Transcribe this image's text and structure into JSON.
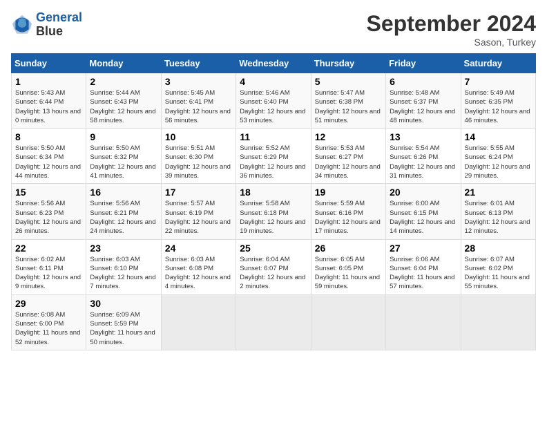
{
  "header": {
    "logo_line1": "General",
    "logo_line2": "Blue",
    "month": "September 2024",
    "location": "Sason, Turkey"
  },
  "weekdays": [
    "Sunday",
    "Monday",
    "Tuesday",
    "Wednesday",
    "Thursday",
    "Friday",
    "Saturday"
  ],
  "weeks": [
    [
      {
        "day": "1",
        "sunrise": "5:43 AM",
        "sunset": "6:44 PM",
        "daylight": "13 hours and 0 minutes."
      },
      {
        "day": "2",
        "sunrise": "5:44 AM",
        "sunset": "6:43 PM",
        "daylight": "12 hours and 58 minutes."
      },
      {
        "day": "3",
        "sunrise": "5:45 AM",
        "sunset": "6:41 PM",
        "daylight": "12 hours and 56 minutes."
      },
      {
        "day": "4",
        "sunrise": "5:46 AM",
        "sunset": "6:40 PM",
        "daylight": "12 hours and 53 minutes."
      },
      {
        "day": "5",
        "sunrise": "5:47 AM",
        "sunset": "6:38 PM",
        "daylight": "12 hours and 51 minutes."
      },
      {
        "day": "6",
        "sunrise": "5:48 AM",
        "sunset": "6:37 PM",
        "daylight": "12 hours and 48 minutes."
      },
      {
        "day": "7",
        "sunrise": "5:49 AM",
        "sunset": "6:35 PM",
        "daylight": "12 hours and 46 minutes."
      }
    ],
    [
      {
        "day": "8",
        "sunrise": "5:50 AM",
        "sunset": "6:34 PM",
        "daylight": "12 hours and 44 minutes."
      },
      {
        "day": "9",
        "sunrise": "5:50 AM",
        "sunset": "6:32 PM",
        "daylight": "12 hours and 41 minutes."
      },
      {
        "day": "10",
        "sunrise": "5:51 AM",
        "sunset": "6:30 PM",
        "daylight": "12 hours and 39 minutes."
      },
      {
        "day": "11",
        "sunrise": "5:52 AM",
        "sunset": "6:29 PM",
        "daylight": "12 hours and 36 minutes."
      },
      {
        "day": "12",
        "sunrise": "5:53 AM",
        "sunset": "6:27 PM",
        "daylight": "12 hours and 34 minutes."
      },
      {
        "day": "13",
        "sunrise": "5:54 AM",
        "sunset": "6:26 PM",
        "daylight": "12 hours and 31 minutes."
      },
      {
        "day": "14",
        "sunrise": "5:55 AM",
        "sunset": "6:24 PM",
        "daylight": "12 hours and 29 minutes."
      }
    ],
    [
      {
        "day": "15",
        "sunrise": "5:56 AM",
        "sunset": "6:23 PM",
        "daylight": "12 hours and 26 minutes."
      },
      {
        "day": "16",
        "sunrise": "5:56 AM",
        "sunset": "6:21 PM",
        "daylight": "12 hours and 24 minutes."
      },
      {
        "day": "17",
        "sunrise": "5:57 AM",
        "sunset": "6:19 PM",
        "daylight": "12 hours and 22 minutes."
      },
      {
        "day": "18",
        "sunrise": "5:58 AM",
        "sunset": "6:18 PM",
        "daylight": "12 hours and 19 minutes."
      },
      {
        "day": "19",
        "sunrise": "5:59 AM",
        "sunset": "6:16 PM",
        "daylight": "12 hours and 17 minutes."
      },
      {
        "day": "20",
        "sunrise": "6:00 AM",
        "sunset": "6:15 PM",
        "daylight": "12 hours and 14 minutes."
      },
      {
        "day": "21",
        "sunrise": "6:01 AM",
        "sunset": "6:13 PM",
        "daylight": "12 hours and 12 minutes."
      }
    ],
    [
      {
        "day": "22",
        "sunrise": "6:02 AM",
        "sunset": "6:11 PM",
        "daylight": "12 hours and 9 minutes."
      },
      {
        "day": "23",
        "sunrise": "6:03 AM",
        "sunset": "6:10 PM",
        "daylight": "12 hours and 7 minutes."
      },
      {
        "day": "24",
        "sunrise": "6:03 AM",
        "sunset": "6:08 PM",
        "daylight": "12 hours and 4 minutes."
      },
      {
        "day": "25",
        "sunrise": "6:04 AM",
        "sunset": "6:07 PM",
        "daylight": "12 hours and 2 minutes."
      },
      {
        "day": "26",
        "sunrise": "6:05 AM",
        "sunset": "6:05 PM",
        "daylight": "11 hours and 59 minutes."
      },
      {
        "day": "27",
        "sunrise": "6:06 AM",
        "sunset": "6:04 PM",
        "daylight": "11 hours and 57 minutes."
      },
      {
        "day": "28",
        "sunrise": "6:07 AM",
        "sunset": "6:02 PM",
        "daylight": "11 hours and 55 minutes."
      }
    ],
    [
      {
        "day": "29",
        "sunrise": "6:08 AM",
        "sunset": "6:00 PM",
        "daylight": "11 hours and 52 minutes."
      },
      {
        "day": "30",
        "sunrise": "6:09 AM",
        "sunset": "5:59 PM",
        "daylight": "11 hours and 50 minutes."
      },
      null,
      null,
      null,
      null,
      null
    ]
  ]
}
